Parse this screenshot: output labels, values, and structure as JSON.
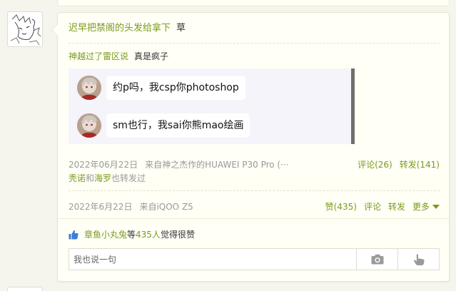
{
  "post": {
    "author": "迟早把禁阁的头发给拿下",
    "text": "草"
  },
  "repost": {
    "author": "神越过了雷区说",
    "text": "真是疯子"
  },
  "image": {
    "bubbles": [
      "约p吗，我csp你photoshop",
      "sm也行，我sai你熊mao绘画"
    ]
  },
  "repost_meta": {
    "time": "2022年06月22日",
    "source": "来自神之杰作的HUAWEI P30 Pro (···",
    "comments": "评论(26)",
    "forwards": "转发(141)",
    "also_user1": "秃诺",
    "also_and": "和",
    "also_user2": "海罗",
    "also_suffix": "也转发过"
  },
  "post_meta": {
    "time": "2022年6月22日",
    "source": "来自iQOO Z5",
    "likes": "赞(435)",
    "comment": "评论",
    "forward": "转发",
    "more": "更多"
  },
  "likes_line": {
    "user": "章鱼小丸兔",
    "mid": " 等",
    "count": "435人",
    "suffix": "觉得很赞"
  },
  "comment_box": {
    "placeholder": "我也说一句"
  },
  "icons": {
    "thumb": "thumbs-up-icon",
    "camera": "camera-icon",
    "hand": "pointing-hand-icon"
  },
  "colors": {
    "accent": "#7a9a1e",
    "meta": "#999999",
    "card_bg": "#fffff6",
    "page_bg": "#f5f5ee",
    "like_icon": "#3d7bd8"
  }
}
